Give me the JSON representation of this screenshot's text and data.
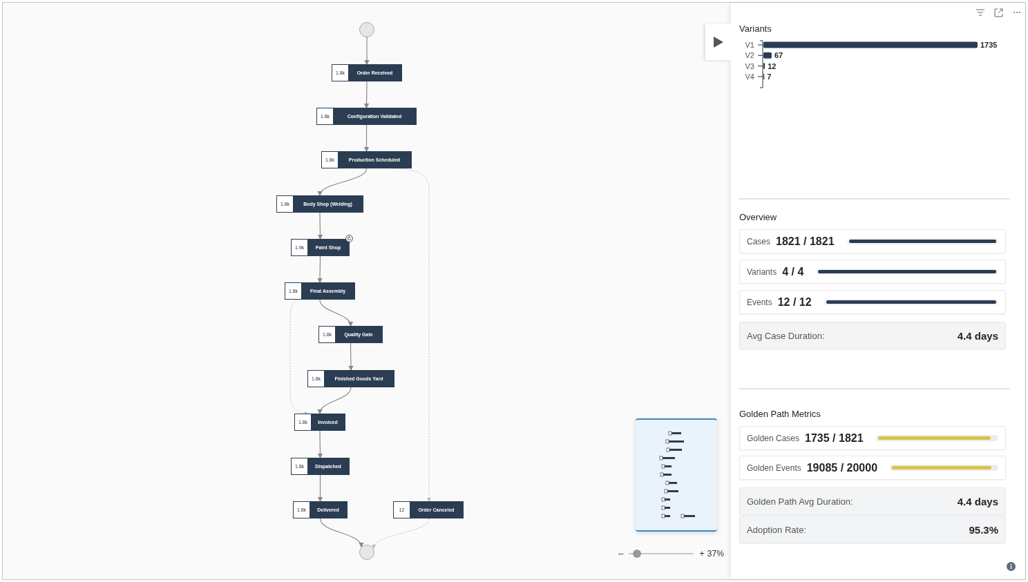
{
  "canvas": {
    "nodes": [
      {
        "count": "1.8k",
        "label": "Order Received",
        "looped": false
      },
      {
        "count": "1.8k",
        "label": "Configuration Validated",
        "looped": false
      },
      {
        "count": "1.8k",
        "label": "Production Scheduled",
        "looped": false
      },
      {
        "count": "1.8k",
        "label": "Body Shop (Welding)",
        "looped": false
      },
      {
        "count": "1.9k",
        "label": "Paint Shop",
        "looped": true
      },
      {
        "count": "1.8k",
        "label": "Final Assembly",
        "looped": false
      },
      {
        "count": "1.8k",
        "label": "Quality Gate",
        "looped": false
      },
      {
        "count": "1.8k",
        "label": "Finished Goods Yard",
        "looped": false
      },
      {
        "count": "1.8k",
        "label": "Invoiced",
        "looped": false
      },
      {
        "count": "1.8k",
        "label": "Dispatched",
        "looped": false
      },
      {
        "count": "1.8k",
        "label": "Delivered",
        "looped": false
      },
      {
        "count": "12",
        "label": "Order Canceled",
        "looped": false
      }
    ]
  },
  "zoom": {
    "minus": "–",
    "plus": "+",
    "level": 0.13,
    "reading": "37%"
  },
  "panel": {
    "variants": {
      "title": "Variants",
      "chart_data": {
        "type": "bar",
        "orientation": "horizontal",
        "categories": [
          "V1",
          "V2",
          "V3",
          "V4"
        ],
        "values": [
          1735,
          67,
          12,
          7
        ],
        "data_labels": true
      }
    },
    "overview": {
      "title": "Overview",
      "cards": [
        {
          "kind": "bar",
          "label": "Cases",
          "value": "1821 / 1821",
          "level": 1
        },
        {
          "kind": "bar",
          "label": "Variants",
          "value": "4 / 4",
          "level": 1
        },
        {
          "kind": "bar",
          "label": "Events",
          "value": "12 / 12",
          "level": 1
        },
        {
          "kind": "stat",
          "label": "Avg Case Duration:",
          "value": "4.4 days"
        }
      ]
    },
    "golden": {
      "title": "Golden Path Metrics",
      "cards": [
        {
          "kind": "golden-bar",
          "label": "Golden Cases",
          "value": "1735 / 1821",
          "level": 0.953
        },
        {
          "kind": "golden-bar",
          "label": "Golden Events",
          "value": "19085 / 20000",
          "level": 0.954
        },
        {
          "kind": "stat",
          "label": "Golden Path Avg Duration:",
          "value": "4.4 days"
        },
        {
          "kind": "stat",
          "label": "Adoption Rate:",
          "value": "95.3%"
        }
      ]
    }
  }
}
